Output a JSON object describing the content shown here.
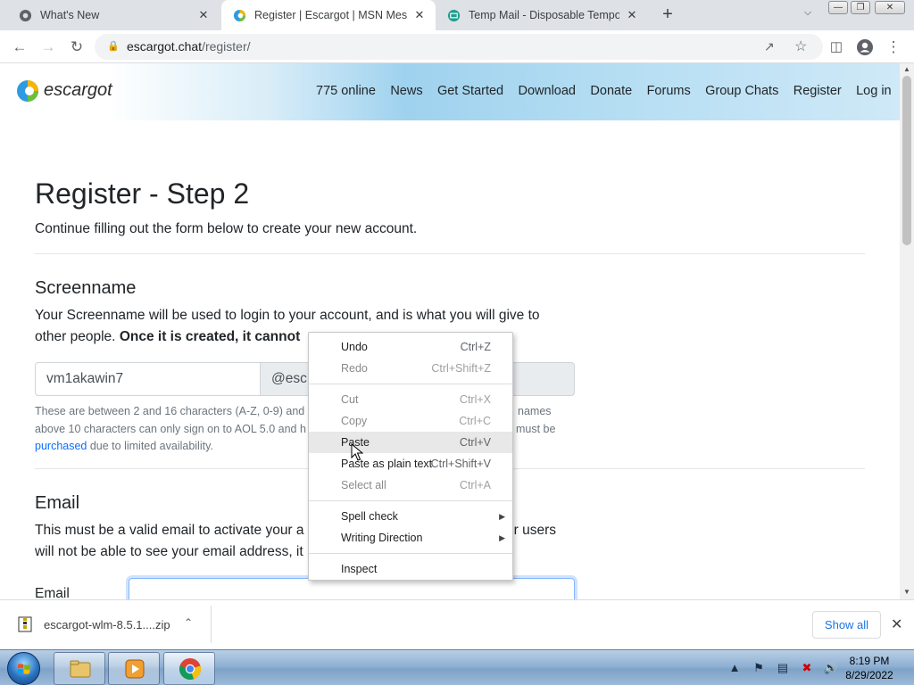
{
  "browser": {
    "tabs": [
      {
        "title": "What's New"
      },
      {
        "title": "Register | Escargot | MSN Messenger"
      },
      {
        "title": "Temp Mail - Disposable Temporary Email"
      }
    ],
    "new_tab": "+",
    "tab_close": "✕",
    "url_host": "escargot.chat",
    "url_path": "/register/"
  },
  "site": {
    "brand": "escargot",
    "nav": [
      "775 online",
      "News",
      "Get Started",
      "Download",
      "Donate",
      "Forums",
      "Group Chats",
      "Register",
      "Log in"
    ]
  },
  "page": {
    "title": "Register - Step 2",
    "lead": "Continue filling out the form below to create your new account.",
    "screenname": {
      "heading": "Screenname",
      "desc_part1": "Your Screenname will be used to login to your account, and is what you will give to other people.",
      "desc_bold": "Once it is created, it cannot",
      "input_value": "vm1akawin7",
      "suffix": "@esc",
      "help_1": "These are between 2 and 16 characters (A-Z, 0-9) and m",
      "help_1b": "names",
      "help_2": "above 10 characters can only sign on to AOL 5.0 and h",
      "help_2b": "must be",
      "help_link": "purchased",
      "help_3": " due to limited availability."
    },
    "email": {
      "heading": "Email",
      "desc_1": "This must be a valid email to activate your a",
      "desc_1b": "er users",
      "desc_2": "will not be able to see your email address, it",
      "label": "Email",
      "value": ""
    }
  },
  "context_menu": {
    "groups": [
      [
        {
          "label": "Undo",
          "shortcut": "Ctrl+Z",
          "disabled": false
        },
        {
          "label": "Redo",
          "shortcut": "Ctrl+Shift+Z",
          "disabled": true
        }
      ],
      [
        {
          "label": "Cut",
          "shortcut": "Ctrl+X",
          "disabled": true
        },
        {
          "label": "Copy",
          "shortcut": "Ctrl+C",
          "disabled": true
        },
        {
          "label": "Paste",
          "shortcut": "Ctrl+V",
          "disabled": false,
          "highlighted": true
        },
        {
          "label": "Paste as plain text",
          "shortcut": "Ctrl+Shift+V",
          "disabled": false
        },
        {
          "label": "Select all",
          "shortcut": "Ctrl+A",
          "disabled": true
        }
      ],
      [
        {
          "label": "Spell check",
          "submenu": true
        },
        {
          "label": "Writing Direction",
          "submenu": true
        }
      ],
      [
        {
          "label": "Inspect"
        }
      ]
    ]
  },
  "downloads": {
    "file": "escargot-wlm-8.5.1....zip",
    "show_all": "Show all"
  },
  "taskbar": {
    "time": "8:19 PM",
    "date": "8/29/2022"
  },
  "colors": {
    "link": "#0d6efd",
    "focus_border": "#86b7fe",
    "chrome_tabstrip": "#dee1e6"
  }
}
